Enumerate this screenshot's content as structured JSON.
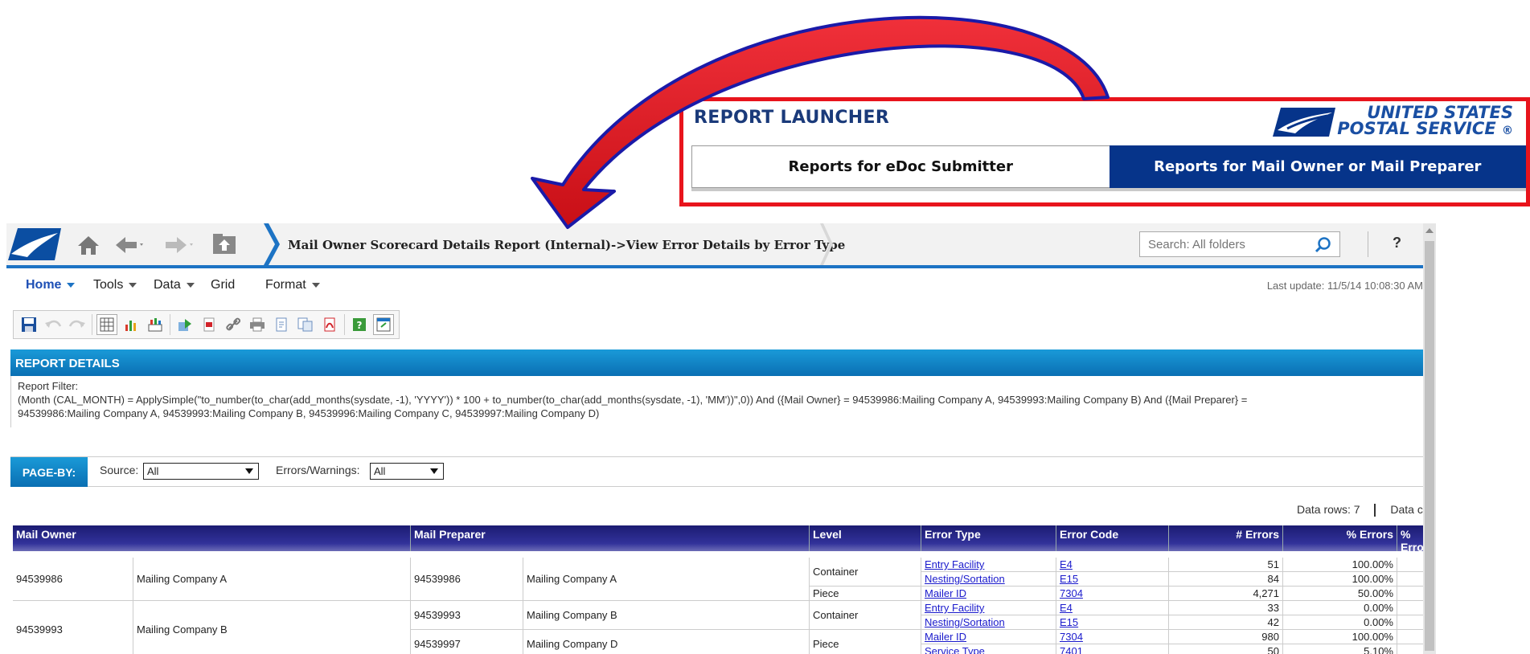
{
  "launcher": {
    "title": "REPORT LAUNCHER",
    "brand_line1": "UNITED STATES",
    "brand_line2": "POSTAL SERVICE",
    "brand_reg": "®",
    "tab_edoc": "Reports for eDoc Submitter",
    "tab_owner": "Reports for Mail Owner or Mail Preparer"
  },
  "topbar": {
    "breadcrumb": "Mail Owner Scorecard Details Report (Internal)->View Error Details by Error Type",
    "search_placeholder": "Search: All folders",
    "help": "?"
  },
  "menu": {
    "home": "Home",
    "tools": "Tools",
    "data": "Data",
    "grid": "Grid",
    "format": "Format",
    "last_update": "Last update: 11/5/14 10:08:30 AM"
  },
  "toolbar_icons": [
    "save-icon",
    "undo-icon",
    "redo-icon",
    "grid-view-icon",
    "graph-view-icon",
    "grid-graph-icon",
    "export-icon",
    "pdf-export-icon",
    "link-icon",
    "print-icon",
    "page-setup-icon",
    "copy-icon",
    "pdf-icon",
    "help-icon",
    "maximize-icon"
  ],
  "report_details": {
    "header": "REPORT DETAILS",
    "filter_label": "Report Filter:",
    "filter_line1": "(Month (CAL_MONTH) = ApplySimple(\"to_number(to_char(add_months(sysdate, -1), 'YYYY')) * 100 + to_number(to_char(add_months(sysdate, -1), 'MM'))\",0)) And ({Mail Owner} = 94539986:Mailing Company A, 94539993:Mailing Company B) And ({Mail Preparer} = ",
    "filter_line2": "94539986:Mailing Company A, 94539993:Mailing Company B, 94539996:Mailing Company C, 94539997:Mailing Company D)"
  },
  "pageby": {
    "label": "PAGE-BY:",
    "source_label": "Source:",
    "source_value": "All",
    "errors_label": "Errors/Warnings:",
    "errors_value": "All"
  },
  "data_rows": "Data rows: 7",
  "data_cols": "Data c",
  "grid": {
    "headers": [
      "Mail Owner",
      "Mail Preparer",
      "Level",
      "Error Type",
      "Error Code",
      "# Errors",
      "% Errors",
      "% Erro"
    ],
    "owners": [
      {
        "id": "94539986",
        "name": "Mailing Company A"
      },
      {
        "id": "94539993",
        "name": "Mailing Company B"
      }
    ],
    "preparers": [
      {
        "id": "94539986",
        "name": "Mailing Company A"
      },
      {
        "id": "94539993",
        "name": "Mailing Company B"
      },
      {
        "id": "94539997",
        "name": "Mailing Company D"
      }
    ],
    "levels": [
      "Container",
      "Piece",
      "Container",
      "Piece"
    ],
    "rows": [
      {
        "type": "Entry Facility",
        "code": "E4",
        "count": "51",
        "pct": "100.00%"
      },
      {
        "type": "Nesting/Sortation",
        "code": "E15",
        "count": "84",
        "pct": "100.00%"
      },
      {
        "type": "Mailer ID",
        "code": "7304",
        "count": "4,271",
        "pct": "50.00%"
      },
      {
        "type": "Entry Facility",
        "code": "E4",
        "count": "33",
        "pct": "0.00%"
      },
      {
        "type": "Nesting/Sortation",
        "code": "E15",
        "count": "42",
        "pct": "0.00%"
      },
      {
        "type": "Mailer ID",
        "code": "7304",
        "count": "980",
        "pct": "100.00%"
      },
      {
        "type": "Service Type",
        "code": "7401",
        "count": "50",
        "pct": "5.10%"
      }
    ]
  },
  "colors": {
    "accent_blue": "#1d73c4",
    "usps_blue": "#06348a",
    "highlight_red": "#e8141c",
    "grid_header": "#1b1b72"
  }
}
